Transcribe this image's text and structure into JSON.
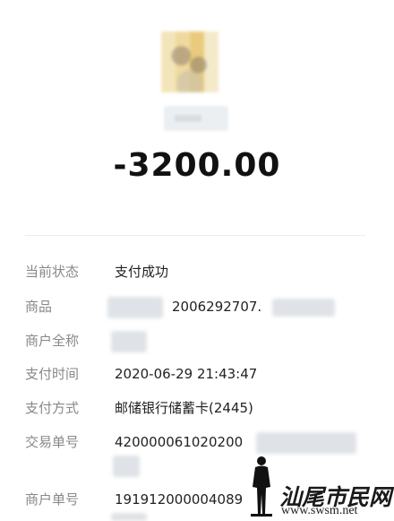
{
  "payment": {
    "amount": "-3200.00"
  },
  "details": [
    {
      "label": "当前状态",
      "value": "支付成功"
    },
    {
      "label": "商品",
      "value": "2006292707."
    },
    {
      "label": "商户全称",
      "value": ""
    },
    {
      "label": "支付时间",
      "value": "2020-06-29 21:43:47"
    },
    {
      "label": "支付方式",
      "value": "邮储银行储蓄卡(2445)"
    },
    {
      "label": "交易单号",
      "value": "420000061020200"
    },
    {
      "label": "商户单号",
      "value": "191912000004089"
    }
  ],
  "watermark": {
    "title": "汕尾市民网",
    "url": "www.swsm.net"
  }
}
